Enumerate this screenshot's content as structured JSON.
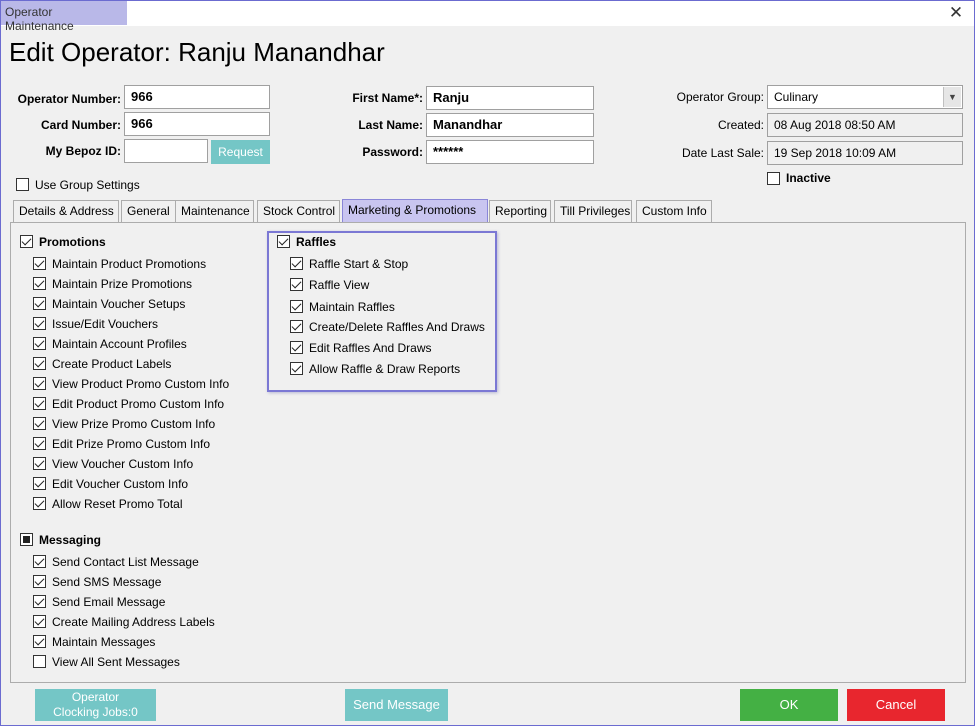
{
  "window": {
    "title": "Operator Maintenance"
  },
  "heading": "Edit Operator: Ranju Manandhar",
  "form": {
    "operator_number_label": "Operator Number:",
    "operator_number": "966",
    "card_number_label": "Card Number:",
    "card_number": "966",
    "bepoz_id_label": "My Bepoz ID:",
    "bepoz_id": "",
    "request_label": "Request",
    "first_name_label": "First Name*:",
    "first_name": "Ranju",
    "last_name_label": "Last Name:",
    "last_name": "Manandhar",
    "password_label": "Password:",
    "password": "******",
    "operator_group_label": "Operator Group:",
    "operator_group": "Culinary",
    "created_label": "Created:",
    "created": "08 Aug 2018 08:50 AM",
    "date_last_sale_label": "Date Last Sale:",
    "date_last_sale": "19 Sep 2018 10:09 AM",
    "inactive_label": "Inactive",
    "use_group_settings_label": "Use Group Settings"
  },
  "tabs": [
    {
      "label": "Details & Address"
    },
    {
      "label": "General"
    },
    {
      "label": "Maintenance"
    },
    {
      "label": "Stock Control"
    },
    {
      "label": "Marketing & Promotions"
    },
    {
      "label": "Reporting"
    },
    {
      "label": "Till Privileges"
    },
    {
      "label": "Custom Info"
    }
  ],
  "promotions": {
    "label": "Promotions",
    "items": [
      {
        "label": "Maintain Product Promotions",
        "checked": true
      },
      {
        "label": "Maintain Prize Promotions",
        "checked": true
      },
      {
        "label": "Maintain Voucher Setups",
        "checked": true
      },
      {
        "label": "Issue/Edit Vouchers",
        "checked": true
      },
      {
        "label": "Maintain Account Profiles",
        "checked": true
      },
      {
        "label": "Create Product Labels",
        "checked": true
      },
      {
        "label": "View Product Promo Custom Info",
        "checked": true
      },
      {
        "label": "Edit Product Promo Custom Info",
        "checked": true
      },
      {
        "label": "View Prize Promo Custom Info",
        "checked": true
      },
      {
        "label": "Edit Prize Promo Custom Info",
        "checked": true
      },
      {
        "label": "View Voucher Custom Info",
        "checked": true
      },
      {
        "label": "Edit Voucher Custom Info",
        "checked": true
      },
      {
        "label": "Allow Reset Promo Total",
        "checked": true
      }
    ]
  },
  "messaging": {
    "label": "Messaging",
    "items": [
      {
        "label": "Send Contact List Message",
        "checked": true
      },
      {
        "label": "Send SMS Message",
        "checked": true
      },
      {
        "label": "Send Email Message",
        "checked": true
      },
      {
        "label": "Create Mailing Address Labels",
        "checked": true
      },
      {
        "label": "Maintain Messages",
        "checked": true
      },
      {
        "label": "View All Sent Messages",
        "checked": false
      }
    ]
  },
  "raffles": {
    "label": "Raffles",
    "items": [
      {
        "label": "Raffle Start & Stop",
        "checked": true
      },
      {
        "label": "Raffle View",
        "checked": true
      },
      {
        "label": "Maintain Raffles",
        "checked": true
      },
      {
        "label": "Create/Delete Raffles And Draws",
        "checked": true
      },
      {
        "label": "Edit Raffles And Draws",
        "checked": true
      },
      {
        "label": "Allow Raffle & Draw Reports",
        "checked": true
      }
    ]
  },
  "footer": {
    "clocking_line1": "Operator",
    "clocking_line2": "Clocking Jobs:0",
    "send_message": "Send Message",
    "ok": "OK",
    "cancel": "Cancel"
  },
  "colors": {
    "teal": "#74c6c6",
    "ok_green": "#44b044",
    "cancel_red": "#e8262e",
    "highlight_border": "#7b78d4"
  }
}
